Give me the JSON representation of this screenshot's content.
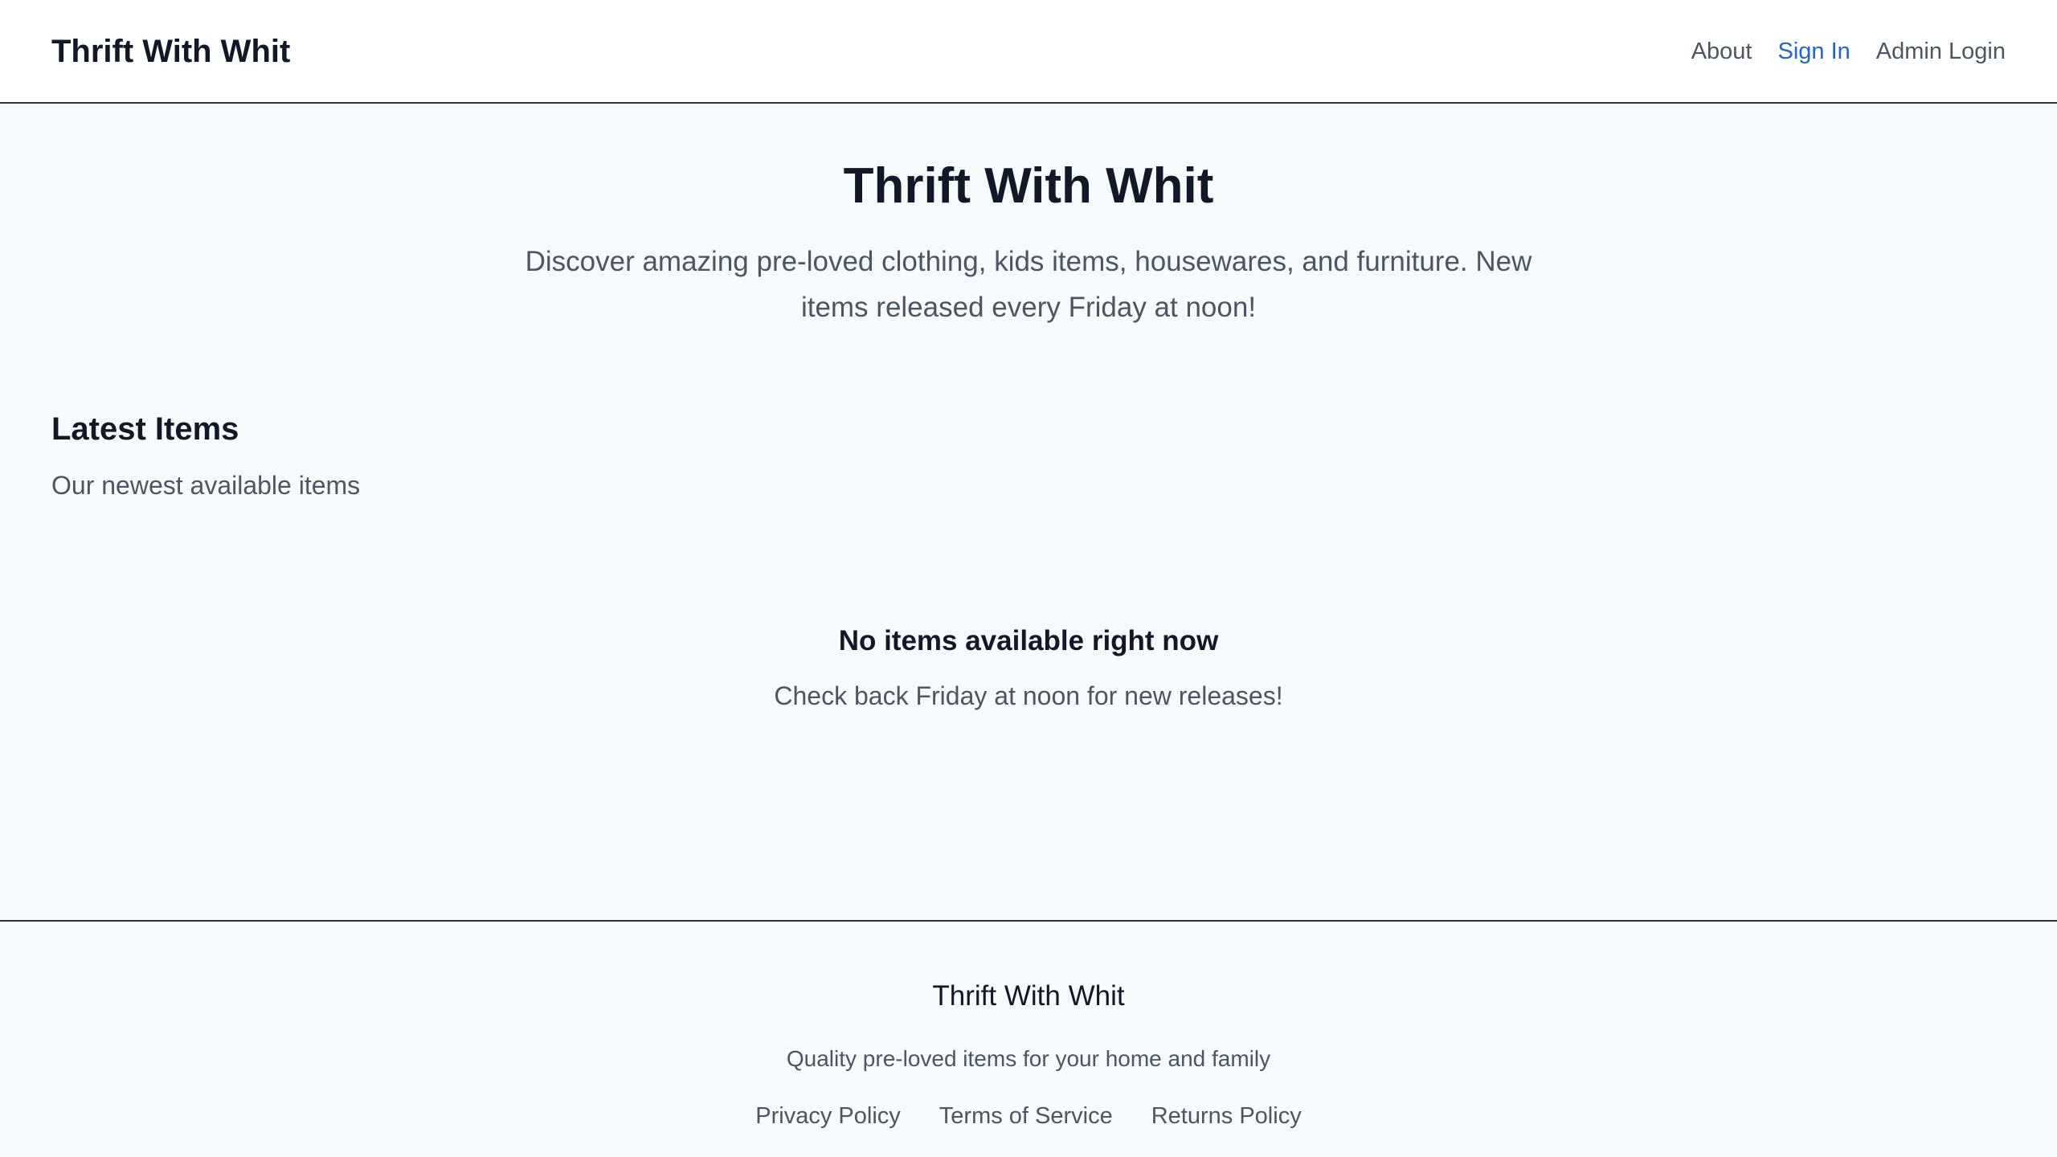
{
  "header": {
    "brand": "Thrift With Whit",
    "nav": [
      {
        "label": "About"
      },
      {
        "label": "Sign In"
      },
      {
        "label": "Admin Login"
      }
    ]
  },
  "hero": {
    "title": "Thrift With Whit",
    "subtitle": "Discover amazing pre-loved clothing, kids items, housewares, and furniture. New items released every Friday at noon!"
  },
  "latest": {
    "title": "Latest Items",
    "subtitle": "Our newest available items",
    "empty_title": "No items available right now",
    "empty_subtitle": "Check back Friday at noon for new releases!"
  },
  "footer": {
    "brand": "Thrift With Whit",
    "tagline": "Quality pre-loved items for your home and family",
    "links": [
      {
        "label": "Privacy Policy"
      },
      {
        "label": "Terms of Service"
      },
      {
        "label": "Returns Policy"
      }
    ]
  },
  "colors": {
    "accent": "#2563c4",
    "text_primary": "#111827",
    "text_secondary": "#4b5563",
    "background": "#f7fafc",
    "header_bg": "#ffffff"
  }
}
